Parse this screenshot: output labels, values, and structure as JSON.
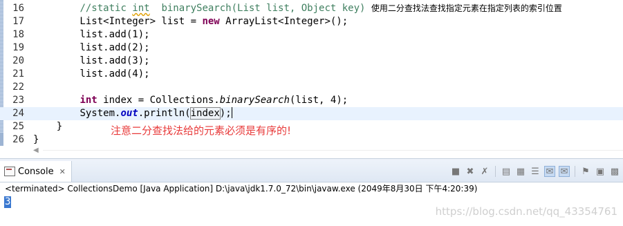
{
  "editor": {
    "lines": [
      {
        "num": "16",
        "indent": "        ",
        "comment": "//static int  binarySearch(List list, Object key) ",
        "comment_cjk": "使用二分查找法查找指定元素在指定列表的索引位置"
      },
      {
        "num": "17",
        "text_a": "        List<Integer> list = ",
        "kw": "new",
        "text_b": " ArrayList<Integer>();"
      },
      {
        "num": "18",
        "text": "        list.add(1);"
      },
      {
        "num": "19",
        "text": "        list.add(2);"
      },
      {
        "num": "20",
        "text": "        list.add(3);"
      },
      {
        "num": "21",
        "text": "        list.add(4);"
      },
      {
        "num": "22",
        "text": ""
      },
      {
        "num": "23",
        "indent": "        ",
        "kw": "int",
        "text_a": " index = Collections.",
        "italic": "binarySearch",
        "text_b": "(list, 4);"
      },
      {
        "num": "24",
        "indent": "        ",
        "text_a": "System.",
        "field": "out",
        "text_b": ".println(",
        "highlight": "index",
        "text_c": ");"
      },
      {
        "num": "25",
        "text": "    }"
      },
      {
        "num": "26",
        "text": "}"
      }
    ],
    "annotation": "注意二分查找法给的元素必须是有序的!"
  },
  "console": {
    "tab_label": "Console",
    "tab_close": "✕",
    "status": "<terminated> CollectionsDemo [Java Application] D:\\java\\jdk1.7.0_72\\bin\\javaw.exe (2049年8月30日 下午4:20:39)",
    "output": "3",
    "toolbar_icons": [
      "terminate-icon",
      "remove-launch-icon",
      "remove-all-terminated-icon",
      "clear-console-icon",
      "scroll-lock-icon",
      "word-wrap-icon",
      "show-on-stdout-icon",
      "show-on-stderr-icon",
      "pin-console-icon",
      "display-console-icon",
      "open-console-icon"
    ]
  },
  "watermark": "https://blog.csdn.net/qq_43354761"
}
